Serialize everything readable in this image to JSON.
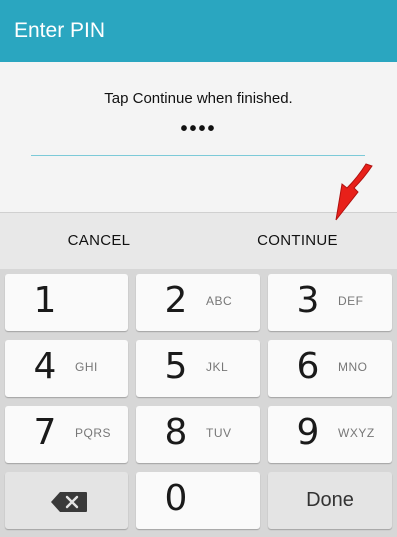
{
  "header": {
    "title": "Enter PIN"
  },
  "prompt": {
    "instruction": "Tap Continue when finished.",
    "pin_masked": "••••"
  },
  "actions": {
    "cancel": "CANCEL",
    "continue": "CONTINUE"
  },
  "keypad": {
    "keys": [
      {
        "digit": "1",
        "letters": ""
      },
      {
        "digit": "2",
        "letters": "ABC"
      },
      {
        "digit": "3",
        "letters": "DEF"
      },
      {
        "digit": "4",
        "letters": "GHI"
      },
      {
        "digit": "5",
        "letters": "JKL"
      },
      {
        "digit": "6",
        "letters": "MNO"
      },
      {
        "digit": "7",
        "letters": "PQRS"
      },
      {
        "digit": "8",
        "letters": "TUV"
      },
      {
        "digit": "9",
        "letters": "WXYZ"
      },
      {
        "digit": "0",
        "letters": ""
      }
    ],
    "done": "Done",
    "backspace_icon": "backspace-icon"
  },
  "colors": {
    "header": "#2aa6c0",
    "pin_line": "#7ccad8",
    "arrow": "#e8201a"
  },
  "annotation": {
    "icon": "red-arrow-icon"
  }
}
